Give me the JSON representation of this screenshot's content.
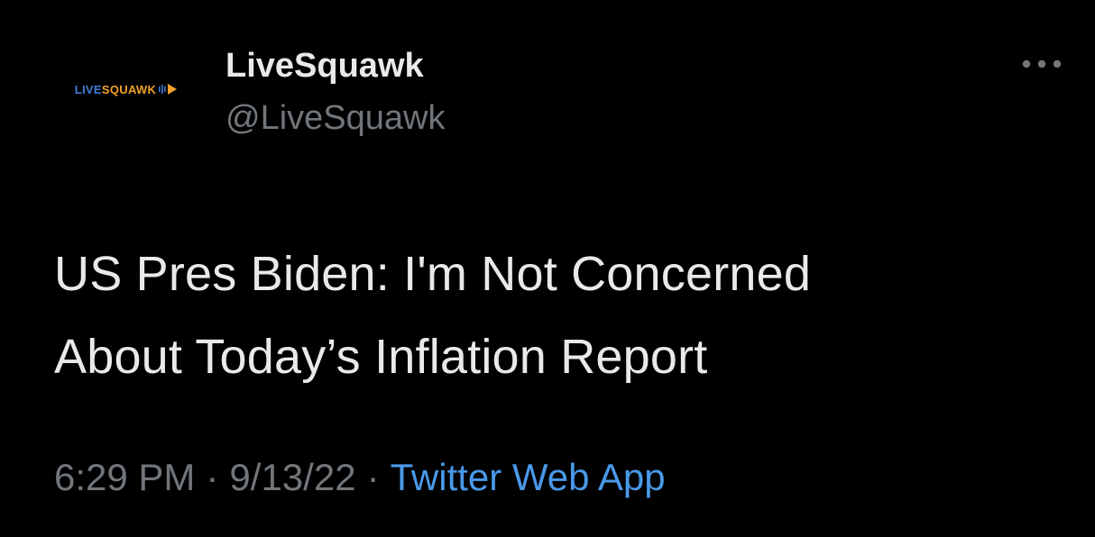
{
  "author": {
    "display_name": "LiveSquawk",
    "handle": "@LiveSquawk",
    "avatar_logo": {
      "text_part1": "LIVE",
      "text_part2": "SQUAWK",
      "icon": "speaker-play-icon",
      "color_part1": "#3d7bd6",
      "color_part2": "#f0a12b"
    }
  },
  "tweet": {
    "text_lines": [
      "US Pres Biden: I'm Not Concerned",
      "About Today’s Inflation Report"
    ],
    "time": "6:29 PM",
    "date": "9/13/22",
    "separator": "·",
    "source": "Twitter Web App"
  },
  "colors": {
    "background": "#000000",
    "primary_text": "#e7e9ea",
    "secondary_text": "#71767b",
    "link": "#4a99e9"
  },
  "icons": {
    "more": "more-horizontal-icon"
  }
}
